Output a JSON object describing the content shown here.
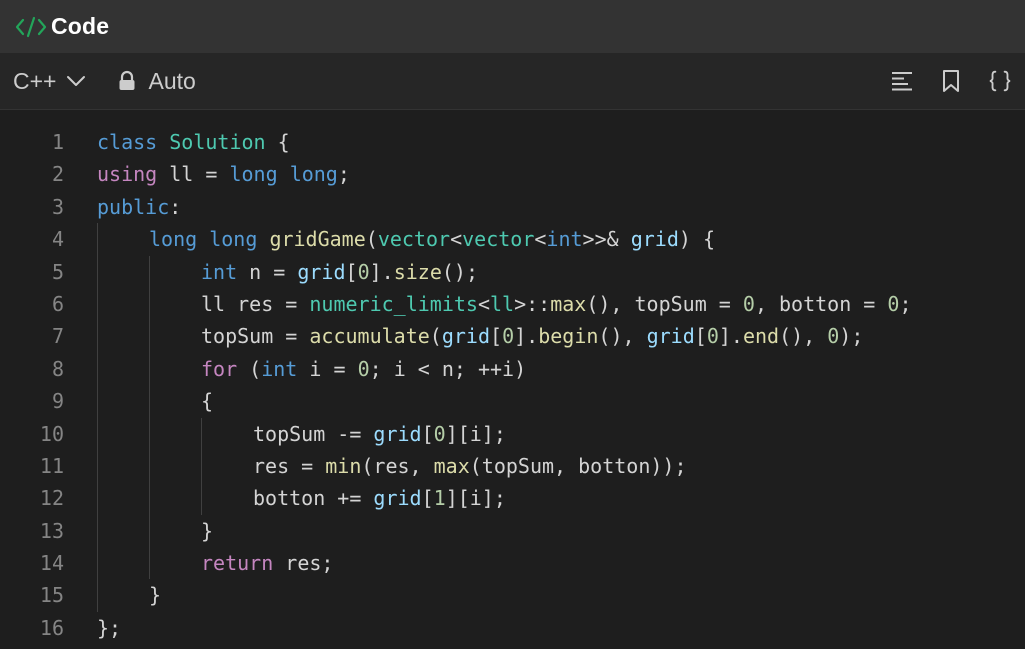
{
  "window": {
    "title": "Code",
    "icon": "code-brackets-icon",
    "accent_color": "#23a55a"
  },
  "toolbar": {
    "language": "C++",
    "mode": "Auto",
    "icons": [
      "format-lines-icon",
      "bookmark-icon",
      "braces-icon"
    ]
  },
  "editor": {
    "theme": {
      "background": "#1e1e1e",
      "keyword": "#569cd6",
      "control": "#c586c0",
      "type": "#4ec9b0",
      "function": "#dcdcaa",
      "parameter": "#9cdcfe",
      "number": "#b5cea8",
      "text": "#d4d4d4",
      "line_number": "#858585"
    },
    "lines": [
      {
        "n": "1",
        "indent": 0,
        "tokens": [
          [
            "k",
            "class"
          ],
          [
            "p",
            " "
          ],
          [
            "t",
            "Solution"
          ],
          [
            "p",
            " {"
          ]
        ]
      },
      {
        "n": "2",
        "indent": 0,
        "tokens": [
          [
            "c",
            "using"
          ],
          [
            "p",
            " ll = "
          ],
          [
            "k",
            "long"
          ],
          [
            "p",
            " "
          ],
          [
            "k",
            "long"
          ],
          [
            "p",
            ";"
          ]
        ]
      },
      {
        "n": "3",
        "indent": 0,
        "tokens": [
          [
            "k",
            "public"
          ],
          [
            "p",
            ":"
          ]
        ]
      },
      {
        "n": "4",
        "indent": 1,
        "tokens": [
          [
            "k",
            "long"
          ],
          [
            "p",
            " "
          ],
          [
            "k",
            "long"
          ],
          [
            "p",
            " "
          ],
          [
            "f",
            "gridGame"
          ],
          [
            "p",
            "("
          ],
          [
            "t",
            "vector"
          ],
          [
            "p",
            "<"
          ],
          [
            "t",
            "vector"
          ],
          [
            "p",
            "<"
          ],
          [
            "k",
            "int"
          ],
          [
            "p",
            ">>& "
          ],
          [
            "v",
            "grid"
          ],
          [
            "p",
            ") {"
          ]
        ]
      },
      {
        "n": "5",
        "indent": 2,
        "tokens": [
          [
            "k",
            "int"
          ],
          [
            "p",
            " n = "
          ],
          [
            "v",
            "grid"
          ],
          [
            "p",
            "["
          ],
          [
            "n",
            "0"
          ],
          [
            "p",
            "]."
          ],
          [
            "f",
            "size"
          ],
          [
            "p",
            "();"
          ]
        ]
      },
      {
        "n": "6",
        "indent": 2,
        "tokens": [
          [
            "p",
            "ll res = "
          ],
          [
            "t",
            "numeric_limits"
          ],
          [
            "p",
            "<"
          ],
          [
            "t",
            "ll"
          ],
          [
            "p",
            ">::"
          ],
          [
            "f",
            "max"
          ],
          [
            "p",
            "(), topSum = "
          ],
          [
            "n",
            "0"
          ],
          [
            "p",
            ", botton = "
          ],
          [
            "n",
            "0"
          ],
          [
            "p",
            ";"
          ]
        ]
      },
      {
        "n": "7",
        "indent": 2,
        "tokens": [
          [
            "p",
            "topSum = "
          ],
          [
            "f",
            "accumulate"
          ],
          [
            "p",
            "("
          ],
          [
            "v",
            "grid"
          ],
          [
            "p",
            "["
          ],
          [
            "n",
            "0"
          ],
          [
            "p",
            "]."
          ],
          [
            "f",
            "begin"
          ],
          [
            "p",
            "(), "
          ],
          [
            "v",
            "grid"
          ],
          [
            "p",
            "["
          ],
          [
            "n",
            "0"
          ],
          [
            "p",
            "]."
          ],
          [
            "f",
            "end"
          ],
          [
            "p",
            "(), "
          ],
          [
            "n",
            "0"
          ],
          [
            "p",
            ");"
          ]
        ]
      },
      {
        "n": "8",
        "indent": 2,
        "tokens": [
          [
            "c",
            "for"
          ],
          [
            "p",
            " ("
          ],
          [
            "k",
            "int"
          ],
          [
            "p",
            " i = "
          ],
          [
            "n",
            "0"
          ],
          [
            "p",
            "; i < n; ++i)"
          ]
        ]
      },
      {
        "n": "9",
        "indent": 2,
        "tokens": [
          [
            "p",
            "{"
          ]
        ]
      },
      {
        "n": "10",
        "indent": 3,
        "tokens": [
          [
            "p",
            "topSum -= "
          ],
          [
            "v",
            "grid"
          ],
          [
            "p",
            "["
          ],
          [
            "n",
            "0"
          ],
          [
            "p",
            "][i];"
          ]
        ]
      },
      {
        "n": "11",
        "indent": 3,
        "tokens": [
          [
            "p",
            "res = "
          ],
          [
            "f",
            "min"
          ],
          [
            "p",
            "(res, "
          ],
          [
            "f",
            "max"
          ],
          [
            "p",
            "(topSum, botton));"
          ]
        ]
      },
      {
        "n": "12",
        "indent": 3,
        "tokens": [
          [
            "p",
            "botton += "
          ],
          [
            "v",
            "grid"
          ],
          [
            "p",
            "["
          ],
          [
            "n",
            "1"
          ],
          [
            "p",
            "][i];"
          ]
        ]
      },
      {
        "n": "13",
        "indent": 2,
        "tokens": [
          [
            "p",
            "}"
          ]
        ]
      },
      {
        "n": "14",
        "indent": 2,
        "tokens": [
          [
            "c",
            "return"
          ],
          [
            "p",
            " res;"
          ]
        ]
      },
      {
        "n": "15",
        "indent": 1,
        "tokens": [
          [
            "p",
            "}"
          ]
        ]
      },
      {
        "n": "16",
        "indent": 0,
        "tokens": [
          [
            "p",
            "};"
          ]
        ]
      }
    ]
  }
}
